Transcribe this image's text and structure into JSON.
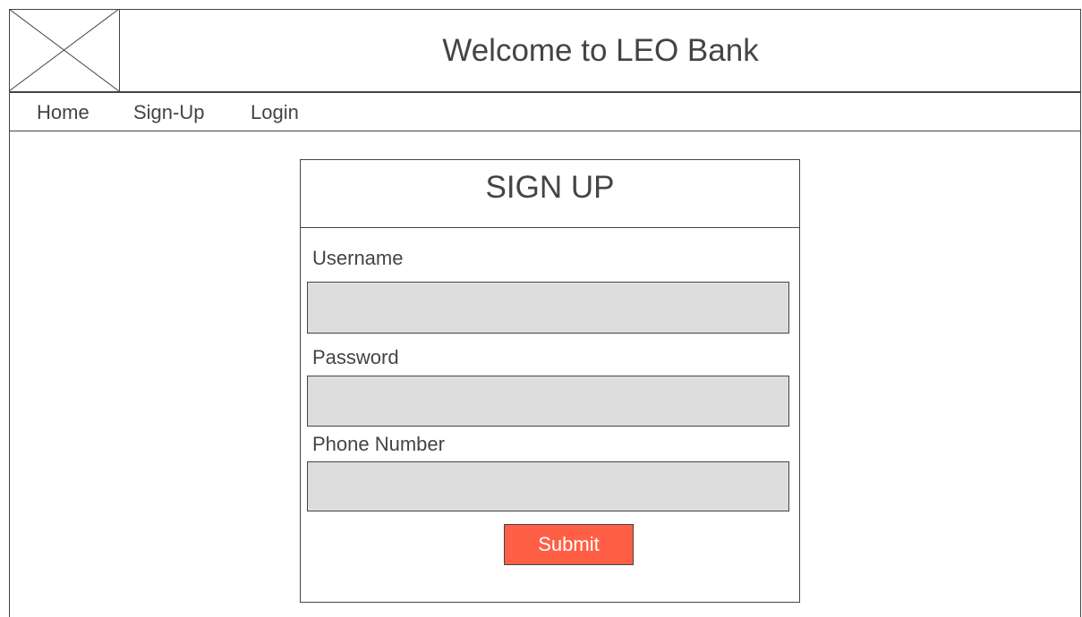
{
  "header": {
    "title": "Welcome to LEO Bank",
    "logo_icon": "image-placeholder-icon"
  },
  "nav": {
    "items": [
      {
        "label": "Home"
      },
      {
        "label": "Sign-Up"
      },
      {
        "label": "Login"
      }
    ]
  },
  "signup_form": {
    "title": "SIGN UP",
    "fields": [
      {
        "label": "Username",
        "value": "",
        "placeholder": ""
      },
      {
        "label": "Password",
        "value": "",
        "placeholder": ""
      },
      {
        "label": "Phone Number",
        "value": "",
        "placeholder": ""
      }
    ],
    "submit_label": "Submit"
  },
  "colors": {
    "text": "#444444",
    "border": "#444444",
    "input_background": "#dddddd",
    "submit_background": "#ff5f45",
    "submit_text": "#ffffff"
  }
}
